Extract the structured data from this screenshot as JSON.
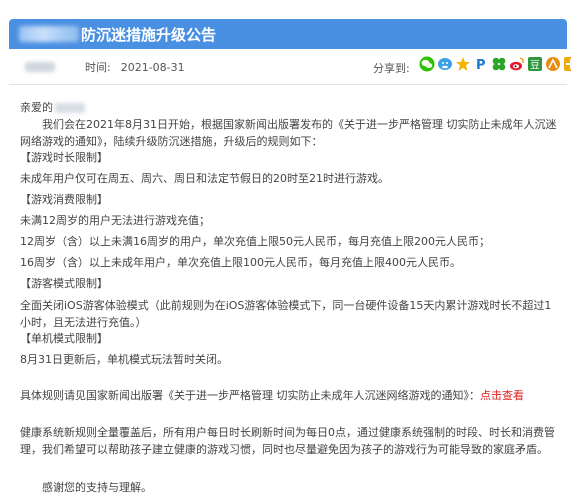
{
  "header": {
    "title": "防沉迷措施升级公告"
  },
  "meta": {
    "time_label": "时间:",
    "time_value": "2021-08-31",
    "share_label": "分享到:",
    "share_icons": [
      "wechat-icon",
      "qq-icon",
      "qzone-star-icon",
      "paipai-icon",
      "clover-icon",
      "weibo-icon",
      "douban-icon",
      "renren-icon",
      "more-icon"
    ]
  },
  "body": {
    "greeting": "亲爱的",
    "intro": "我们会在2021年8月31日开始，根据国家新闻出版署发布的《关于进一步严格管理 切实防止未成年人沉迷网络游戏的通知》，陆续升级防沉迷措施，升级后的规则如下：",
    "sec1_title": "【游戏时长限制】",
    "sec1_line1": "未成年用户仅可在周五、周六、周日和法定节假日的20时至21时进行游戏。",
    "sec2_title": "【游戏消费限制】",
    "sec2_line1": "未满12周岁的用户无法进行游戏充值；",
    "sec2_line2": "12周岁（含）以上未满16周岁的用户，单次充值上限50元人民币，每月充值上限200元人民币；",
    "sec2_line3": "16周岁（含）以上未成年用户，单次充值上限100元人民币，每月充值上限400元人民币。",
    "sec3_title": "【游客模式限制】",
    "sec3_line1": "全面关闭iOS游客体验模式（此前规则为在iOS游客体验模式下，同一台硬件设备15天内累计游戏时长不超过1小时，且无法进行充值。）",
    "sec4_title": "【单机模式限制】",
    "sec4_line1": "8月31日更新后，单机模式玩法暂时关闭。",
    "detail_prefix": "具体规则请见国家新闻出版署《关于进一步严格管理 切实防止未成年人沉迷网络游戏的通知》：",
    "detail_link": "点击查看",
    "health": "健康系统新规则全量覆盖后，所有用户每日时长刷新时间为每日0点，通过健康系统强制的时段、时长和消费管理，我们希望可以帮助孩子建立健康的游戏习惯，同时也尽量避免因为孩子的游戏行为可能导致的家庭矛盾。",
    "thanks": "感谢您的支持与理解。"
  }
}
